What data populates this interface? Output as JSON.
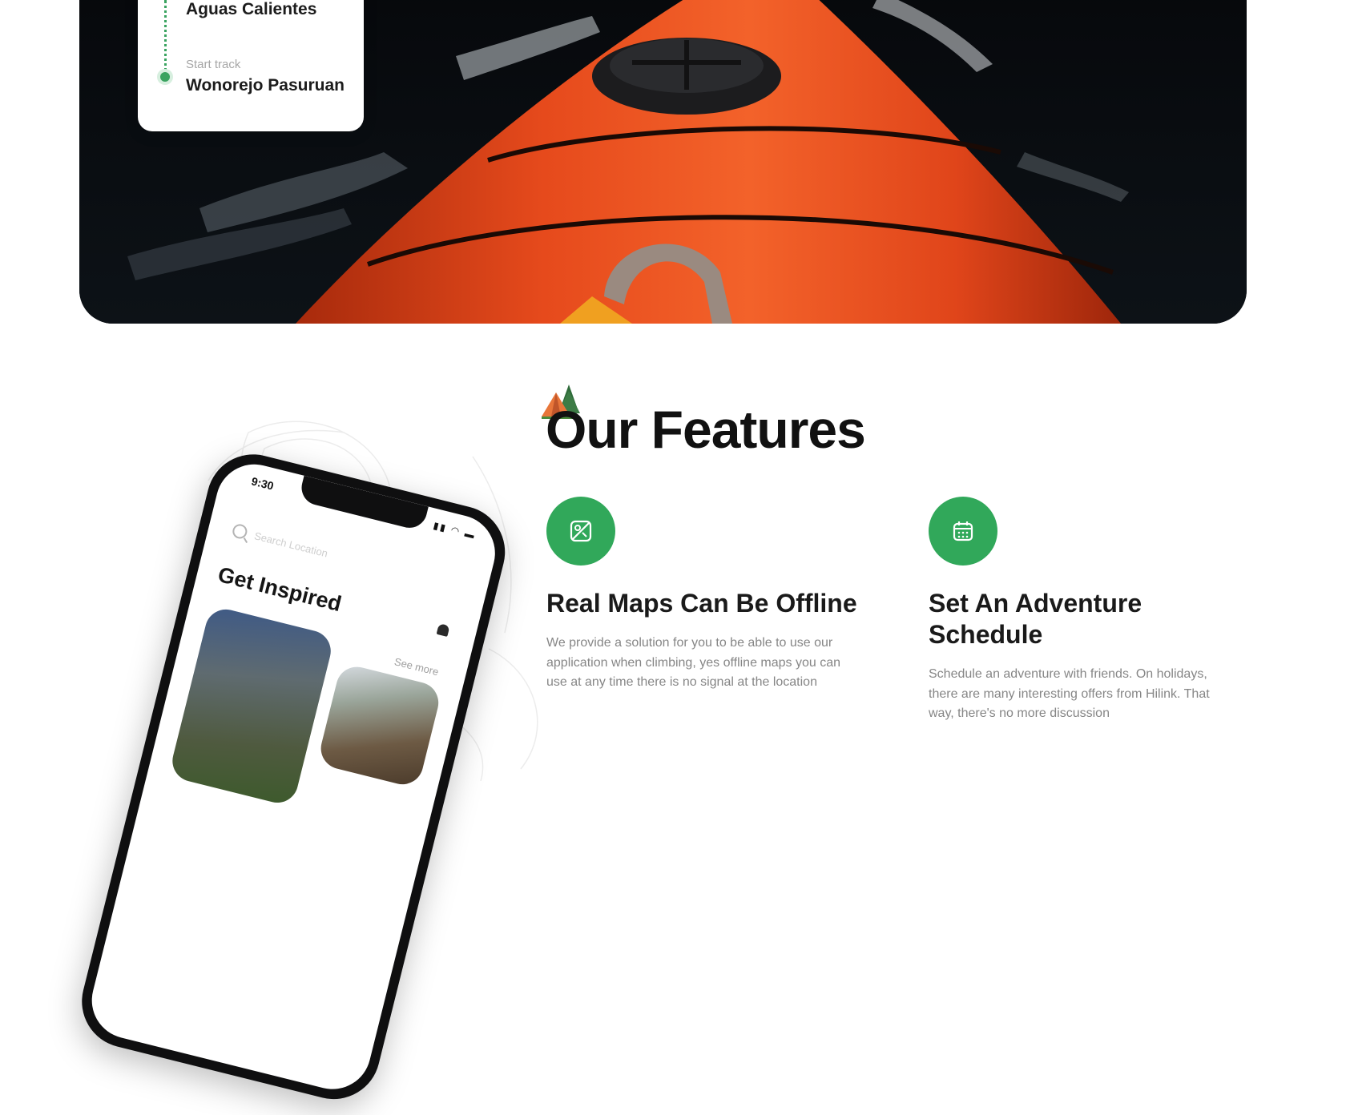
{
  "route_card": {
    "destination": "Aguas Calientes",
    "start_label": "Start track",
    "start_location": "Wonorejo Pasuruan"
  },
  "phone": {
    "time": "9:30",
    "search_placeholder": "Search Location",
    "title": "Get Inspired",
    "see_more": "See more"
  },
  "features": {
    "title": "Our Features",
    "items": [
      {
        "icon": "map-icon",
        "title": "Real Maps Can Be Offline",
        "description": "We provide a solution for you to be able to use our application when climbing, yes offline maps you can use at any time there is no signal at the location"
      },
      {
        "icon": "calendar-icon",
        "title": "Set An Adventure Schedule",
        "description": "Schedule an adventure with friends. On holidays, there are many interesting offers from Hilink. That way, there's no more discussion"
      }
    ]
  },
  "colors": {
    "accent_green": "#31a85a",
    "kayak_orange": "#e8441a"
  }
}
